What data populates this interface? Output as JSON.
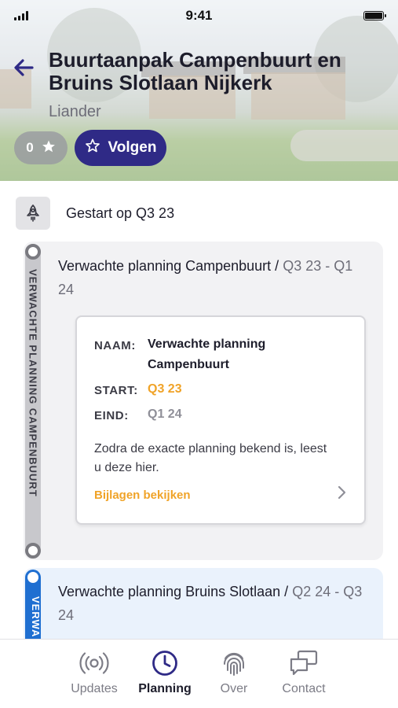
{
  "status_bar": {
    "time": "9:41"
  },
  "header": {
    "title": "Buurtaanpak Campenbuurt en Bruins Slotlaan Nijkerk",
    "subtitle": "Liander",
    "rating_count": "0",
    "follow_label": "Volgen"
  },
  "started": {
    "label": "Gestart op Q3 23"
  },
  "phases": [
    {
      "rail_label": "VERWACHTE PLANNING CAMPENBUURT",
      "title": "Verwachte planning Campenbuurt / ",
      "period": "Q3 23 - Q1 24",
      "detail": {
        "name_label": "NAAM:",
        "name_value": "Verwachte planning Campenbuurt",
        "start_label": "START:",
        "start_value": "Q3 23",
        "end_label": "EIND:",
        "end_value": "Q1 24",
        "description": "Zodra de exacte planning bekend is, leest u deze hier.",
        "attachments_link": "Bijlagen bekijken"
      }
    },
    {
      "rail_label": "VERWA",
      "title": "Verwachte planning Bruins Slotlaan / ",
      "period": "Q2 24 - Q3 24"
    }
  ],
  "tabs": [
    {
      "label": "Updates",
      "icon": "broadcast-icon",
      "active": false
    },
    {
      "label": "Planning",
      "icon": "clock-icon",
      "active": true
    },
    {
      "label": "Over",
      "icon": "fingerprint-icon",
      "active": false
    },
    {
      "label": "Contact",
      "icon": "chat-icon",
      "active": false
    }
  ],
  "colors": {
    "brand_primary": "#2f2a86",
    "accent_orange": "#f0a328",
    "active_phase_blue": "#1f6fd1"
  }
}
